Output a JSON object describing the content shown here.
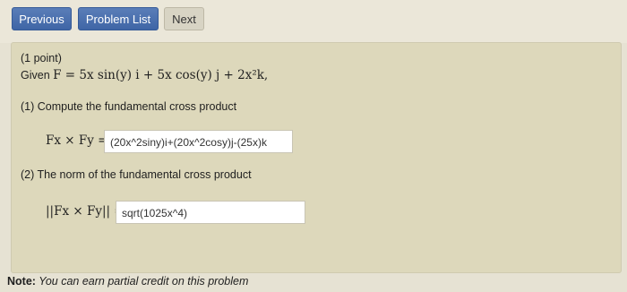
{
  "nav": {
    "previous_label": "Previous",
    "problem_list_label": "Problem List",
    "next_label": "Next"
  },
  "problem": {
    "points": "(1 point)",
    "given_prefix": "Given ",
    "given_expr": "F = 5x sin(y) i + 5x cos(y) j + 2x²k,",
    "part1_prompt": "(1) Compute the fundamental cross product",
    "part1_label": "Fx × Fy =",
    "part1_answer": "(20x^2siny)i+(20x^2cosy)j-(25x)k",
    "part2_prompt": "(2) The norm of the fundamental cross product",
    "part2_label": "||Fx × Fy|| =",
    "part2_answer": "sqrt(1025x^4)"
  },
  "note": {
    "label": "Note:",
    "text": " You can earn partial credit on this problem"
  }
}
